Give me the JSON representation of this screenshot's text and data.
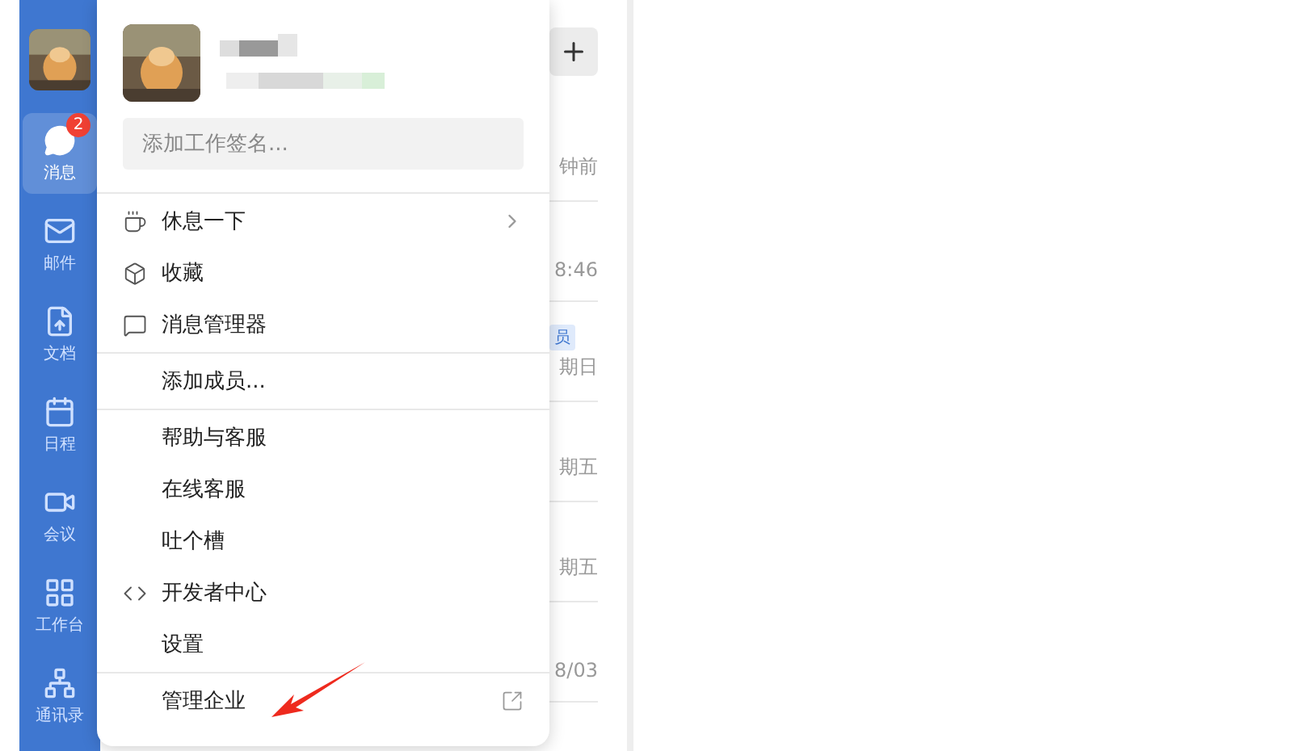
{
  "sidebar": {
    "items": [
      {
        "label": "消息",
        "selected": true,
        "badge": "2"
      },
      {
        "label": "邮件",
        "selected": false
      },
      {
        "label": "文档",
        "selected": false
      },
      {
        "label": "日程",
        "selected": false
      },
      {
        "label": "会议",
        "selected": false
      },
      {
        "label": "工作台",
        "selected": false
      },
      {
        "label": "通讯录",
        "selected": false
      }
    ]
  },
  "conversation_list": {
    "rows": [
      {
        "time": "钟前"
      },
      {
        "time": "8:46"
      },
      {
        "time": "期日",
        "tag": "员"
      },
      {
        "time": "期五"
      },
      {
        "time": "期五"
      },
      {
        "time": "8/03"
      }
    ]
  },
  "profile_menu": {
    "signature": {
      "placeholder": "添加工作签名..."
    },
    "groups": [
      [
        {
          "label": "休息一下",
          "kind": "submenu"
        },
        {
          "label": "收藏",
          "kind": "plain"
        },
        {
          "label": "消息管理器",
          "kind": "plain"
        }
      ],
      [
        {
          "label": "添加成员...",
          "kind": "plain"
        }
      ],
      [
        {
          "label": "帮助与客服",
          "kind": "plain"
        },
        {
          "label": "在线客服",
          "kind": "plain"
        },
        {
          "label": "吐个槽",
          "kind": "plain"
        },
        {
          "label": "开发者中心",
          "kind": "plain"
        },
        {
          "label": "设置",
          "kind": "plain"
        }
      ],
      [
        {
          "label": "管理企业",
          "kind": "external"
        }
      ]
    ]
  }
}
